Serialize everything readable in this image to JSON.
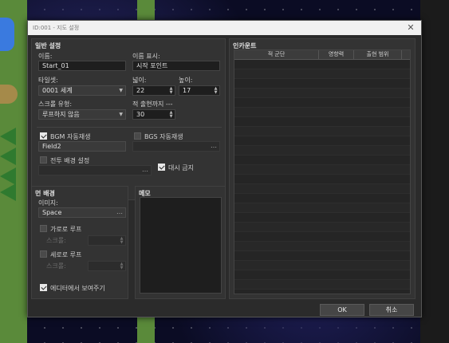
{
  "dialog": {
    "title": "ID:001 - 지도 설정",
    "close_symbol": "✕"
  },
  "general": {
    "title": "일반 설정",
    "name_label": "이름:",
    "name_value": "Start_01",
    "display_name_label": "이름 표시:",
    "display_name_value": "시작 포인트",
    "tileset_label": "타일셋:",
    "tileset_value": "0001 세계",
    "width_label": "넓이:",
    "width_value": "22",
    "height_label": "높이:",
    "height_value": "17",
    "scroll_label": "스크롤 유형:",
    "scroll_value": "루프하지 않음",
    "encounter_steps_label": "적 출현까지 ---",
    "encounter_steps_value": "30",
    "bgm_label": "BGM 자동재생",
    "bgm_checked": true,
    "bgm_value": "Field2",
    "bgs_label": "BGS 자동재생",
    "bgs_checked": false,
    "bgs_value": "",
    "battleback_label": "전투 배경 설정",
    "battleback_checked": false,
    "battleback_value": "",
    "disable_dash_label": "대시 금지",
    "disable_dash_checked": true
  },
  "encounters": {
    "title": "인카운트",
    "columns": [
      "적 군단",
      "영향력",
      "출현 범위"
    ],
    "row_count": 25
  },
  "parallax": {
    "title": "먼 배경",
    "image_label": "이미지:",
    "image_value": "Space",
    "loop_h_label": "가로로 루프",
    "loop_h_checked": false,
    "scroll_h_label": "스크롤:",
    "loop_v_label": "세로로 루프",
    "loop_v_checked": false,
    "scroll_v_label": "스크롤:",
    "show_in_editor_label": "에디터에서 보여주기",
    "show_in_editor_checked": true
  },
  "memo": {
    "title": "메모",
    "text": ""
  },
  "buttons": {
    "ok": "OK",
    "cancel": "취소"
  },
  "colors": {
    "dialog_bg": "#2b2b2b",
    "panel_bg": "#333333",
    "titlebar_bg": "#f1f1f1"
  }
}
